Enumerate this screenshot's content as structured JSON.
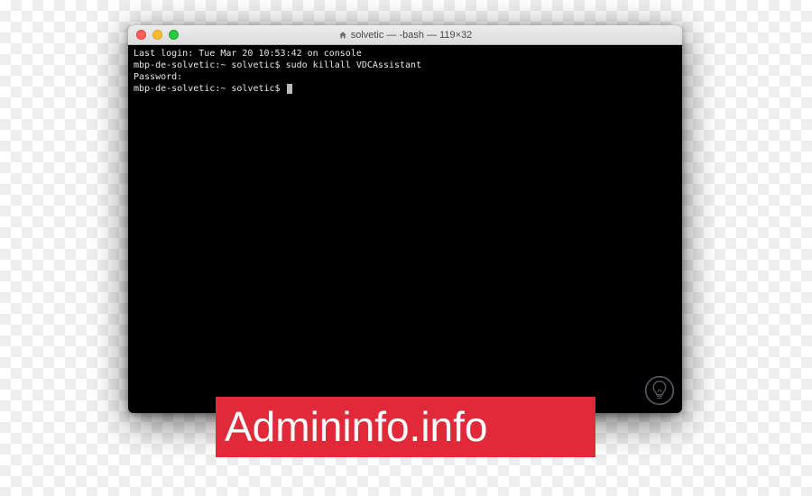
{
  "window": {
    "title": "solvetic — -bash — 119×32"
  },
  "terminal": {
    "line1": "Last login: Tue Mar 20 10:53:42 on console",
    "line2_prompt": "mbp-de-solvetic:~ solvetic$ ",
    "line2_cmd": "sudo killall VDCAssistant",
    "line3": "Password:",
    "line4_prompt": "mbp-de-solvetic:~ solvetic$ "
  },
  "banner": {
    "text": "Admininfo.info"
  }
}
